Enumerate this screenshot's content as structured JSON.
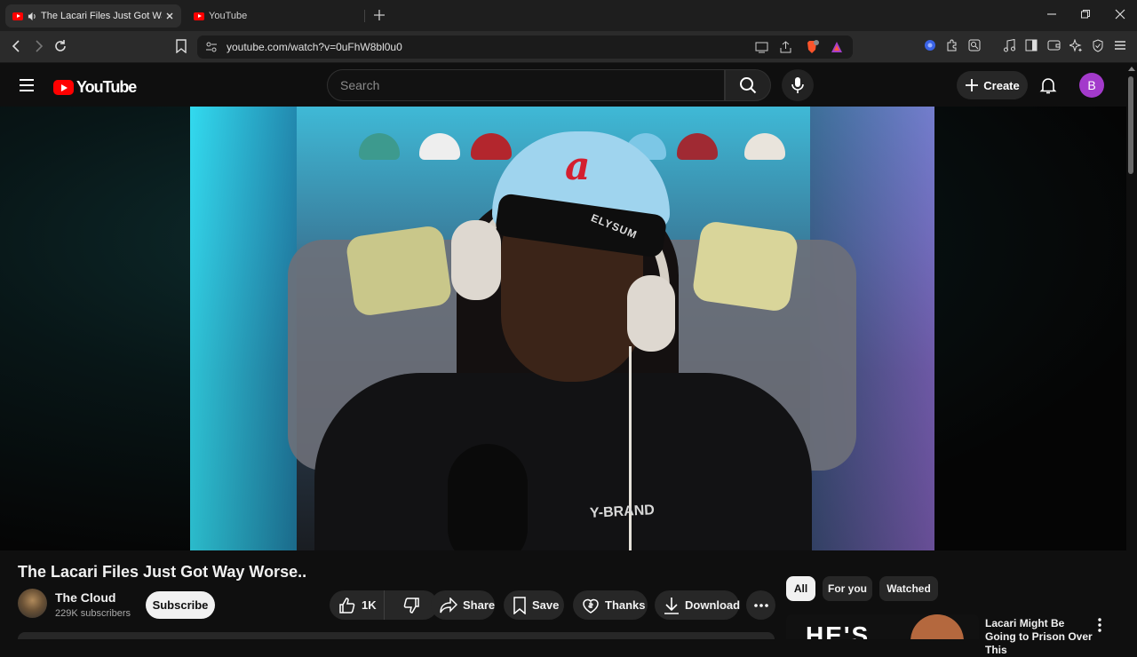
{
  "browser": {
    "tabs": [
      {
        "title": "The Lacari Files Just Got Way Worse..",
        "active": true
      },
      {
        "title": "YouTube",
        "active": false
      }
    ],
    "url": "youtube.com/watch?v=0uFhW8bl0u0"
  },
  "youtube": {
    "logo_text": "YouTube",
    "search_placeholder": "Search",
    "create_label": "Create",
    "avatar_letter": "B"
  },
  "video": {
    "cap_letter": "a",
    "band_text": "ELYSUM",
    "shirt_text": "Y-BRAND",
    "title": "The Lacari Files Just Got Way Worse..",
    "channel_name": "The Cloud",
    "subscribers": "229K subscribers",
    "subscribe_label": "Subscribe",
    "like_count": "1K",
    "actions": {
      "share": "Share",
      "save": "Save",
      "thanks": "Thanks",
      "download": "Download"
    }
  },
  "sidebar": {
    "chips": [
      "All",
      "For you",
      "Watched"
    ],
    "selected_chip": "All",
    "recommendation": {
      "title": "Lacari Might Be Going to Prison Over This",
      "thumb_text": "HE'S"
    }
  },
  "colors": {
    "youtube_red": "#ff0000",
    "avatar_purple": "#a33acb",
    "background": "#0f0f0f"
  }
}
